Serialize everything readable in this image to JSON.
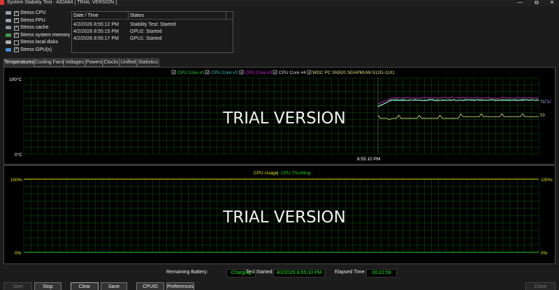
{
  "window": {
    "title": "System Stability Test - AIDA64  [ TRIAL VERSION ]",
    "minimize_glyph": "—",
    "maximize_glyph": "⧉",
    "close_glyph": "✕"
  },
  "stress_options": [
    {
      "label": "Stress CPU",
      "checked": true,
      "icon": "cpu-chip-icon",
      "color": "#9aa0a6"
    },
    {
      "label": "Stress FPU",
      "checked": true,
      "icon": "fpu-chip-icon",
      "color": "#9aa0a6"
    },
    {
      "label": "Stress cache",
      "checked": true,
      "icon": "cache-chip-icon",
      "color": "#8a8f94"
    },
    {
      "label": "Stress system memory",
      "checked": true,
      "icon": "memory-module-icon",
      "color": "#3f9a48"
    },
    {
      "label": "Stress local disks",
      "checked": false,
      "icon": "disk-drive-icon",
      "color": "#b0b0b0"
    },
    {
      "label": "Stress GPU(s)",
      "checked": true,
      "icon": "gpu-card-icon",
      "color": "#4a8ad8"
    }
  ],
  "status_table": {
    "headers": [
      "Date / Time",
      "Status"
    ],
    "rows": [
      [
        "4/2/2026 8:55:12 PM",
        "Stability Test: Started"
      ],
      [
        "4/2/2026 8:55:15 PM",
        "GPU2: Started"
      ],
      [
        "4/2/2026 8:55:17 PM",
        "GPU1: Started"
      ]
    ]
  },
  "tabs": [
    "Temperatures",
    "Cooling Fans",
    "Voltages",
    "Powers",
    "Clocks",
    "Unified",
    "Statistics"
  ],
  "active_tab": "Temperatures",
  "temp_chart": {
    "legend": [
      {
        "label": "CPU Core #1",
        "color": "#22dd22"
      },
      {
        "label": "CPU Core #2",
        "color": "#22cccc"
      },
      {
        "label": "CPU Core #3",
        "color": "#dd22dd"
      },
      {
        "label": "CPU Core #4",
        "color": "#e0e0e0"
      },
      {
        "label": "WDC PC SN520 SDAPMUW-512G-1101",
        "color": "#e0e080"
      }
    ],
    "ymax_label": "100°C",
    "ymin_label": "0°C",
    "ylim": [
      0,
      100
    ],
    "time_label": "8:55:10 PM",
    "watermark": "TRIAL VERSION",
    "end_labels": [
      "71",
      "71",
      "74",
      "53"
    ],
    "grid_color": "#0b5a0b"
  },
  "usage_chart": {
    "legend": [
      {
        "label": "CPU Usage",
        "color": "#e6e600"
      },
      {
        "label": "CPU Throttling",
        "color": "#22cc22"
      }
    ],
    "legend_sep": "|",
    "ymax_left": "100%",
    "ymin_left": "0%",
    "ymax_right": "100%",
    "ymin_right": "0%",
    "watermark": "TRIAL VERSION",
    "cpu_usage_percent": 100,
    "cpu_throttling_percent": 0
  },
  "chart_data": [
    {
      "type": "line",
      "ylim": [
        0,
        100
      ],
      "ylabel_top": "100°C",
      "ylabel_bottom": "0°C",
      "x_marker": "8:55:10 PM",
      "series": [
        {
          "name": "CPU Core #1",
          "end_value": 71
        },
        {
          "name": "CPU Core #2",
          "end_value": 71
        },
        {
          "name": "CPU Core #3",
          "end_value": 74
        },
        {
          "name": "CPU Core #4",
          "end_value": 71
        },
        {
          "name": "WDC PC SN520 SDAPMUW-512G-1101",
          "end_value": 53
        }
      ]
    },
    {
      "type": "line",
      "ylim": [
        0,
        100
      ],
      "series": [
        {
          "name": "CPU Usage",
          "values": [
            100
          ]
        },
        {
          "name": "CPU Throttling",
          "values": [
            0
          ]
        }
      ]
    }
  ],
  "footer": {
    "battery_label": "Remaining Battery:",
    "battery_value": "Charging",
    "started_label": "Test Started:",
    "started_value": "4/2/2026 8:55:10 PM",
    "elapsed_label": "Elapsed Time:",
    "elapsed_value": "00:22:59"
  },
  "buttons": {
    "start": "Start",
    "stop": "Stop",
    "clear": "Clear",
    "save": "Save",
    "cpuid": "CPUID",
    "preferences": "Preferences",
    "close": "Close"
  }
}
